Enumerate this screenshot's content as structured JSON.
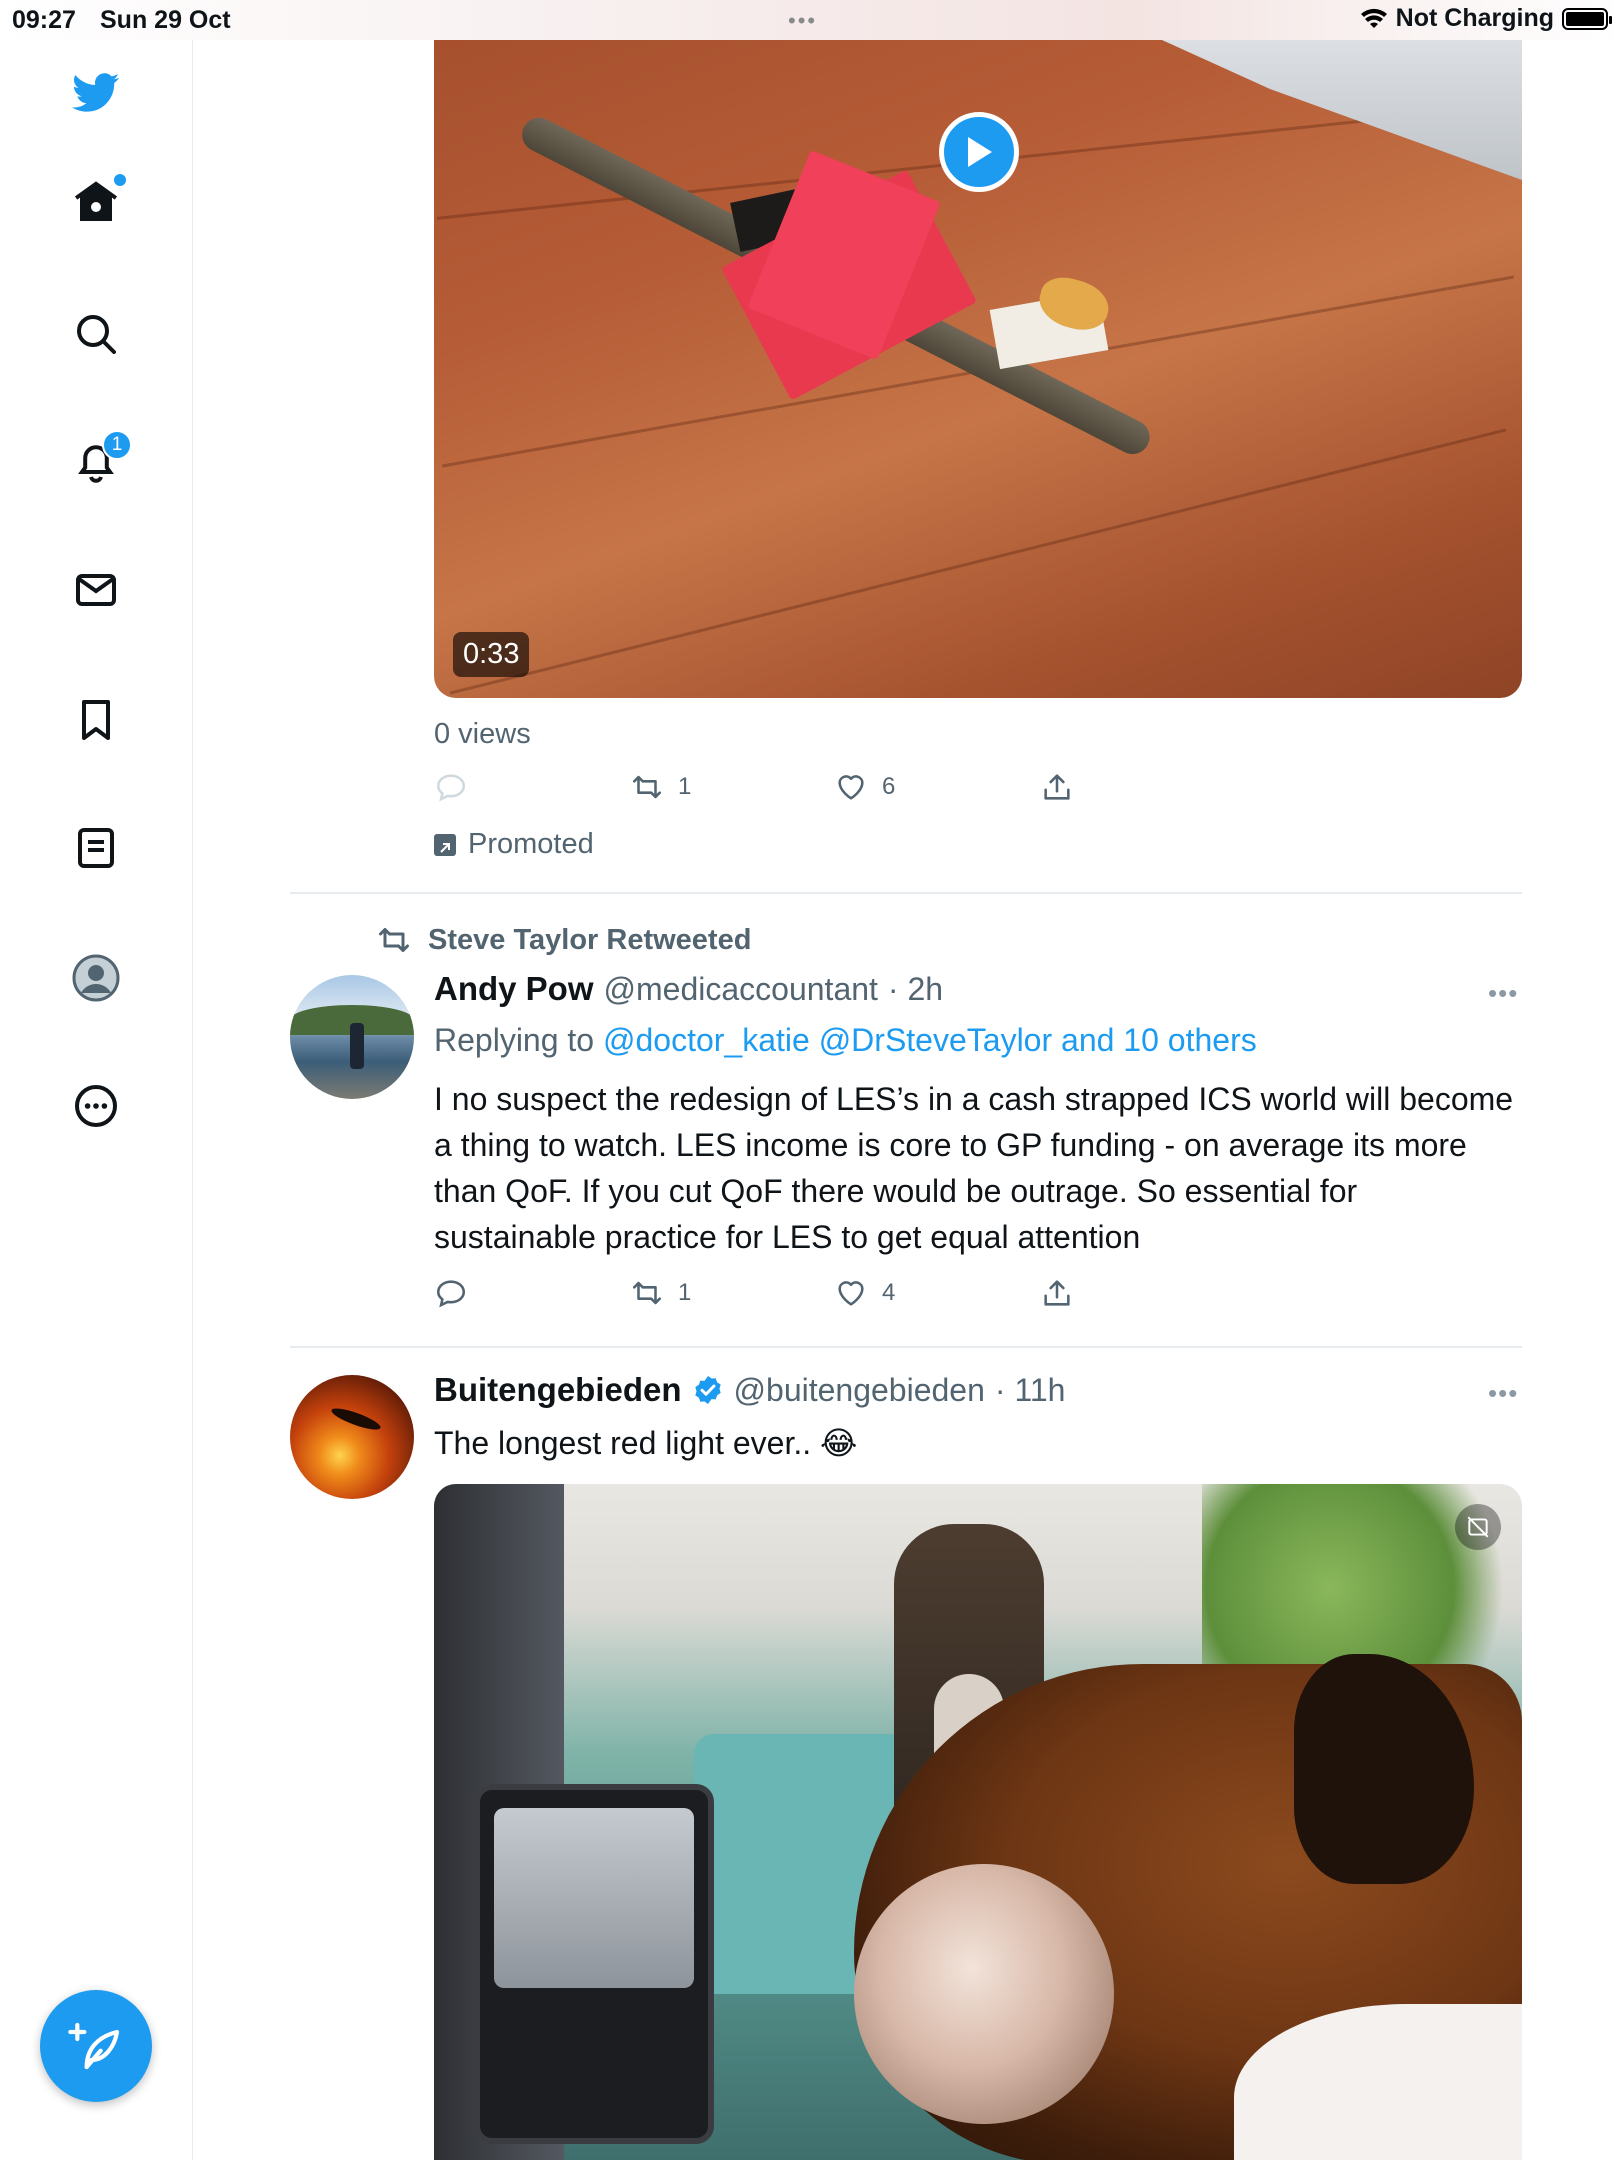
{
  "status_bar": {
    "time": "09:27",
    "date": "Sun 29 Oct",
    "multitask_dots": "•••",
    "charging": "Not Charging"
  },
  "sidebar": {
    "items": [
      {
        "name": "twitter-logo-icon"
      },
      {
        "name": "home-icon",
        "has_dot": true
      },
      {
        "name": "search-icon"
      },
      {
        "name": "notifications-icon",
        "badge": "1"
      },
      {
        "name": "messages-icon"
      },
      {
        "name": "bookmarks-icon"
      },
      {
        "name": "lists-icon"
      },
      {
        "name": "profile-icon"
      },
      {
        "name": "more-icon"
      }
    ],
    "compose_icon": "compose-tweet-icon"
  },
  "tweet1": {
    "video_duration": "0:33",
    "views": "0 views",
    "retweets": "1",
    "likes": "6",
    "promoted_label": "Promoted"
  },
  "tweet2": {
    "retweeted_by": "Steve Taylor Retweeted",
    "name": "Andy Pow",
    "handle": "@medicaccountant",
    "time": "· 2h",
    "reply_prefix": "Replying to ",
    "reply_mentions": "@doctor_katie @DrSteveTaylor and 10 others",
    "text": "I no suspect the redesign of LES’s in a cash strapped ICS world will become a thing to watch. LES income is core to GP funding - on average its more than QoF. If you cut QoF there would be outrage. So essential for sustainable practice for LES to get equal attention",
    "retweets": "1",
    "likes": "4"
  },
  "tweet3": {
    "name": "Buitengebieden",
    "handle": "@buitengebieden",
    "time": "· 11h",
    "text": "The longest red light ever.. 😂"
  },
  "colors": {
    "accent": "#1d9bf0",
    "secondary_text": "#536471",
    "divider": "#e6ecf0"
  }
}
